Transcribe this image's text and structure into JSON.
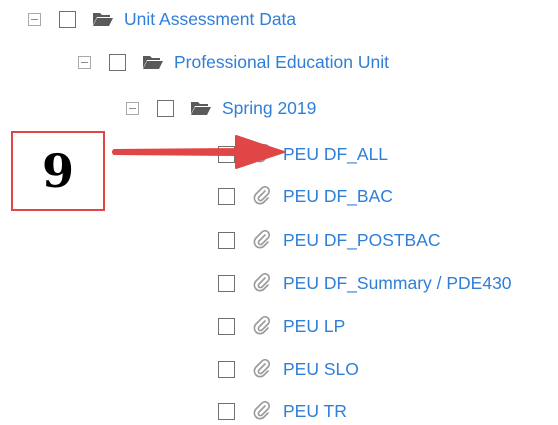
{
  "tree": {
    "root": {
      "label": "Unit Assessment Data",
      "icon": "folder-open-icon"
    },
    "unit": {
      "label": "Professional Education Unit",
      "icon": "folder-open-icon"
    },
    "term": {
      "label": "Spring 2019",
      "icon": "folder-open-icon"
    },
    "files": [
      {
        "label": "PEU DF_ALL",
        "icon": "paperclip-icon"
      },
      {
        "label": "PEU DF_BAC",
        "icon": "paperclip-icon"
      },
      {
        "label": "PEU DF_POSTBAC",
        "icon": "paperclip-icon"
      },
      {
        "label": "PEU DF_Summary / PDE430",
        "icon": "paperclip-icon"
      },
      {
        "label": "PEU LP",
        "icon": "paperclip-icon"
      },
      {
        "label": "PEU SLO",
        "icon": "paperclip-icon"
      },
      {
        "label": "PEU TR",
        "icon": "paperclip-icon"
      }
    ]
  },
  "annotation": {
    "step_number": "9",
    "color": "#e04646"
  },
  "colors": {
    "link": "#2f7ed8",
    "folder": "#5a5a5a",
    "paperclip": "#9a9a9a"
  }
}
